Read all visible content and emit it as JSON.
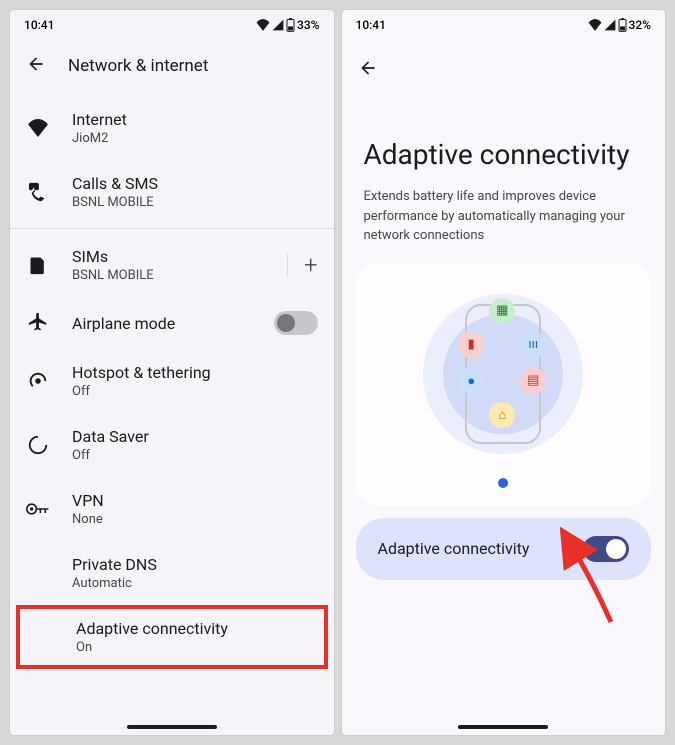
{
  "left": {
    "status": {
      "time": "10:41",
      "battery": "33%"
    },
    "pageTitle": "Network & internet",
    "items": {
      "internet": {
        "title": "Internet",
        "sub": "JioM2"
      },
      "calls": {
        "title": "Calls & SMS",
        "sub": "BSNL MOBILE"
      },
      "sims": {
        "title": "SIMs",
        "sub": "BSNL MOBILE"
      },
      "airplane": {
        "title": "Airplane mode"
      },
      "hotspot": {
        "title": "Hotspot & tethering",
        "sub": "Off"
      },
      "datasaver": {
        "title": "Data Saver",
        "sub": "Off"
      },
      "vpn": {
        "title": "VPN",
        "sub": "None"
      },
      "privatedns": {
        "title": "Private DNS",
        "sub": "Automatic"
      },
      "adaptive": {
        "title": "Adaptive connectivity",
        "sub": "On"
      }
    }
  },
  "right": {
    "status": {
      "time": "10:41",
      "battery": "32%"
    },
    "heroTitle": "Adaptive connectivity",
    "heroDesc": "Extends battery life and improves device performance by automatically managing your network connections",
    "toggleLabel": "Adaptive connectivity",
    "toggleState": "on"
  }
}
